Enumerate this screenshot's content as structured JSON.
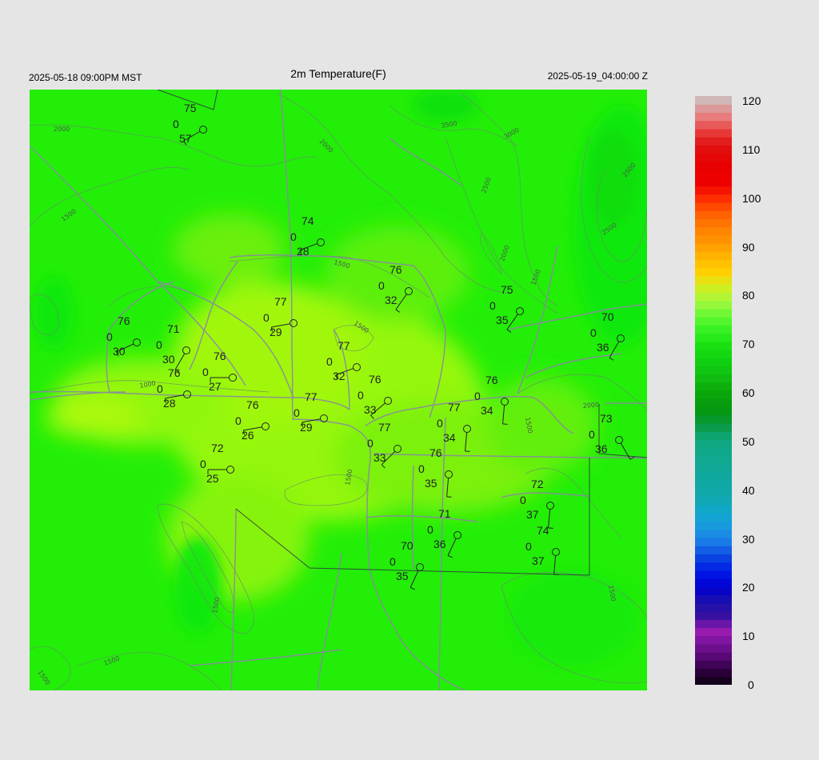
{
  "header": {
    "title": "2m Temperature(F)",
    "local_time": "2025-05-18 09:00PM MST",
    "utc_time": "2025-05-19_04:00:00 Z"
  },
  "colorbar": {
    "labels": [
      "120",
      "110",
      "100",
      "90",
      "80",
      "70",
      "60",
      "50",
      "40",
      "30",
      "20",
      "10",
      "0"
    ],
    "min": 0,
    "max": 120
  },
  "contours": [
    "2000",
    "2000",
    "3500",
    "3000",
    "2500",
    "2000",
    "1500",
    "1500",
    "1500",
    "1000",
    "1500",
    "1500",
    "2000",
    "1500",
    "1500",
    "1500",
    "2500",
    "2500",
    "1500",
    "1500",
    "1500"
  ],
  "stations": [
    {
      "t": "75",
      "mark": "0",
      "d": "57"
    },
    {
      "t": "74",
      "mark": "0",
      "d": "28"
    },
    {
      "t": "76",
      "mark": "0",
      "d": "32"
    },
    {
      "t": "75",
      "mark": "0",
      "d": "35"
    },
    {
      "t": "77",
      "mark": "0",
      "d": "29"
    },
    {
      "t": "76",
      "mark": "0",
      "d": "30"
    },
    {
      "t": "71",
      "mark": "0",
      "d": "30"
    },
    {
      "t": "70",
      "mark": "0",
      "d": "36"
    },
    {
      "t": "77",
      "mark": "0",
      "d": "32"
    },
    {
      "t": "76",
      "mark": "0",
      "d": "27"
    },
    {
      "t": "76",
      "mark": "0",
      "d": "28"
    },
    {
      "t": "76",
      "mark": "0",
      "d": "33"
    },
    {
      "t": "76",
      "mark": "0",
      "d": "34"
    },
    {
      "t": "77",
      "mark": "0",
      "d": "29"
    },
    {
      "t": "76",
      "mark": "0",
      "d": "26"
    },
    {
      "t": "77",
      "mark": "0",
      "d": "34"
    },
    {
      "t": "73",
      "mark": "0",
      "d": "36"
    },
    {
      "t": "77",
      "mark": "0",
      "d": "33"
    },
    {
      "t": "72",
      "mark": "0",
      "d": "25"
    },
    {
      "t": "76",
      "mark": "0",
      "d": "35"
    },
    {
      "t": "72",
      "mark": "0",
      "d": "37"
    },
    {
      "t": "71",
      "mark": "0",
      "d": "36"
    },
    {
      "t": "74",
      "mark": "0",
      "d": "37"
    },
    {
      "t": "70",
      "mark": "0",
      "d": "35"
    }
  ]
}
